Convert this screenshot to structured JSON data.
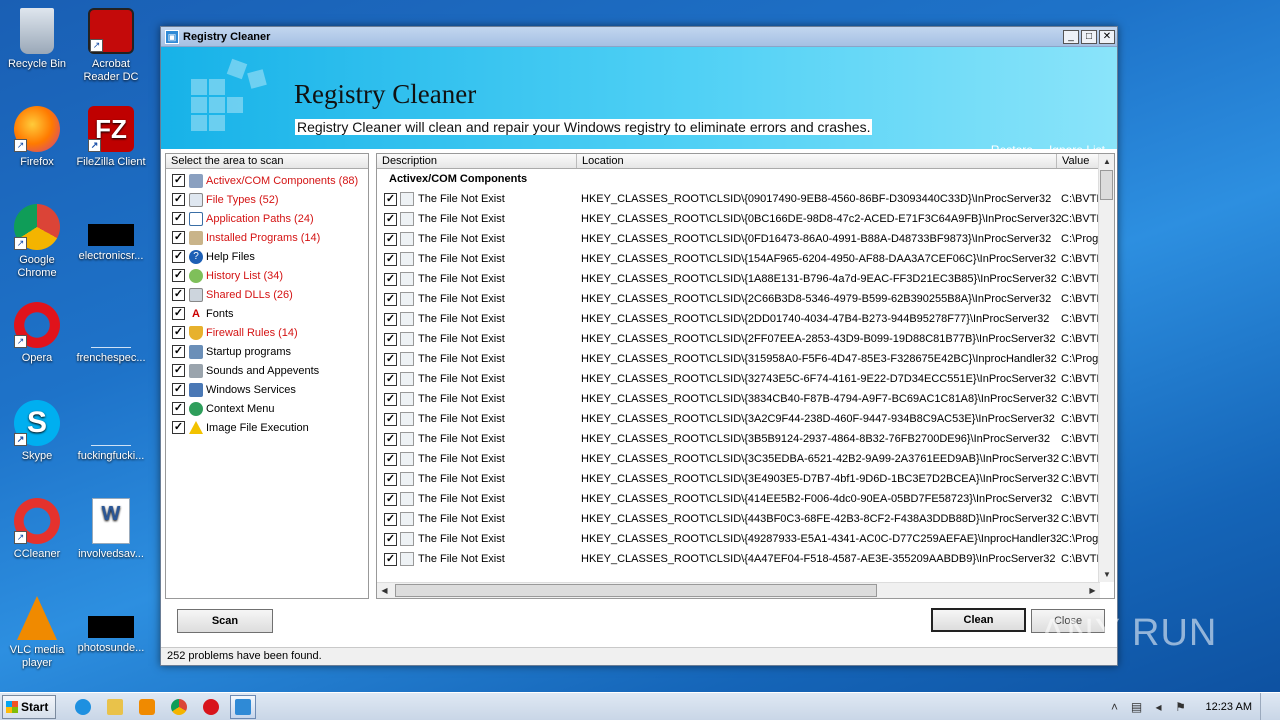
{
  "desktop": {
    "icons": [
      {
        "label": "Recycle Bin"
      },
      {
        "label": "Acrobat Reader DC"
      },
      {
        "label": "Firefox"
      },
      {
        "label": "FileZilla Client"
      },
      {
        "label": "Google Chrome"
      },
      {
        "label": "electronicsr..."
      },
      {
        "label": "Opera"
      },
      {
        "label": "frenchespec..."
      },
      {
        "label": "Skype"
      },
      {
        "label": "fuckingfucki..."
      },
      {
        "label": "CCleaner"
      },
      {
        "label": "involvedsav..."
      },
      {
        "label": "VLC media player"
      },
      {
        "label": "photosunde..."
      }
    ]
  },
  "window": {
    "title": "Registry Cleaner",
    "banner_title": "Registry Cleaner",
    "banner_subtitle": "Registry Cleaner will clean and repair your Windows registry to eliminate errors and crashes.",
    "links": {
      "restore": "Restore",
      "ignore_list": "Ignore List"
    },
    "controls": {
      "minimize": "_",
      "maximize": "□",
      "close": "✕"
    }
  },
  "left_panel": {
    "header": "Select the area to scan",
    "items": [
      {
        "label": "Activex/COM Components (88)",
        "red": true
      },
      {
        "label": "File Types (52)",
        "red": true
      },
      {
        "label": "Application Paths (24)",
        "red": true
      },
      {
        "label": "Installed Programs (14)",
        "red": true
      },
      {
        "label": "Help Files",
        "red": false
      },
      {
        "label": "History List (34)",
        "red": true
      },
      {
        "label": "Shared DLLs (26)",
        "red": true
      },
      {
        "label": "Fonts",
        "red": false
      },
      {
        "label": "Firewall Rules (14)",
        "red": true
      },
      {
        "label": "Startup programs",
        "red": false
      },
      {
        "label": "Sounds and Appevents",
        "red": false
      },
      {
        "label": "Windows Services",
        "red": false
      },
      {
        "label": "Context Menu",
        "red": false
      },
      {
        "label": "Image File Execution",
        "red": false
      }
    ]
  },
  "results": {
    "columns": {
      "description": "Description",
      "location": "Location",
      "value": "Value"
    },
    "group": "Activex/COM Components",
    "rows": [
      {
        "desc": "The File Not Exist",
        "loc": "HKEY_CLASSES_ROOT\\CLSID\\{09017490-9EB8-4560-86BF-D3093440C33D}\\InProcServer32",
        "val": "C:\\BVTE"
      },
      {
        "desc": "The File Not Exist",
        "loc": "HKEY_CLASSES_ROOT\\CLSID\\{0BC166DE-98D8-47c2-ACED-E71F3C64A9FB}\\InProcServer32",
        "val": "C:\\BVTE"
      },
      {
        "desc": "The File Not Exist",
        "loc": "HKEY_CLASSES_ROOT\\CLSID\\{0FD16473-86A0-4991-B88A-D48733BF9873}\\InProcServer32",
        "val": "C:\\Prog"
      },
      {
        "desc": "The File Not Exist",
        "loc": "HKEY_CLASSES_ROOT\\CLSID\\{154AF965-6204-4950-AF88-DAA3A7CEF06C}\\InProcServer32",
        "val": "C:\\BVTE"
      },
      {
        "desc": "The File Not Exist",
        "loc": "HKEY_CLASSES_ROOT\\CLSID\\{1A88E131-B796-4a7d-9EAC-FF3D21EC3B85}\\InProcServer32",
        "val": "C:\\BVTE"
      },
      {
        "desc": "The File Not Exist",
        "loc": "HKEY_CLASSES_ROOT\\CLSID\\{2C66B3D8-5346-4979-B599-62B390255B8A}\\InProcServer32",
        "val": "C:\\BVTE"
      },
      {
        "desc": "The File Not Exist",
        "loc": "HKEY_CLASSES_ROOT\\CLSID\\{2DD01740-4034-47B4-B273-944B95278F77}\\InProcServer32",
        "val": "C:\\BVTE"
      },
      {
        "desc": "The File Not Exist",
        "loc": "HKEY_CLASSES_ROOT\\CLSID\\{2FF07EEA-2853-43D9-B099-19D88C81B77B}\\InProcServer32",
        "val": "C:\\BVTE"
      },
      {
        "desc": "The File Not Exist",
        "loc": "HKEY_CLASSES_ROOT\\CLSID\\{315958A0-F5F6-4D47-85E3-F328675E42BC}\\InprocHandler32",
        "val": "C:\\Prog"
      },
      {
        "desc": "The File Not Exist",
        "loc": "HKEY_CLASSES_ROOT\\CLSID\\{32743E5C-6F74-4161-9E22-D7D34ECC551E}\\InProcServer32",
        "val": "C:\\BVTE"
      },
      {
        "desc": "The File Not Exist",
        "loc": "HKEY_CLASSES_ROOT\\CLSID\\{3834CB40-F87B-4794-A9F7-BC69AC1C81A8}\\InProcServer32",
        "val": "C:\\BVTE"
      },
      {
        "desc": "The File Not Exist",
        "loc": "HKEY_CLASSES_ROOT\\CLSID\\{3A2C9F44-238D-460F-9447-934B8C9AC53E}\\InProcServer32",
        "val": "C:\\BVTE"
      },
      {
        "desc": "The File Not Exist",
        "loc": "HKEY_CLASSES_ROOT\\CLSID\\{3B5B9124-2937-4864-8B32-76FB2700DE96}\\InProcServer32",
        "val": "C:\\BVTE"
      },
      {
        "desc": "The File Not Exist",
        "loc": "HKEY_CLASSES_ROOT\\CLSID\\{3C35EDBA-6521-42B2-9A99-2A3761EED9AB}\\InProcServer32",
        "val": "C:\\BVTE"
      },
      {
        "desc": "The File Not Exist",
        "loc": "HKEY_CLASSES_ROOT\\CLSID\\{3E4903E5-D7B7-4bf1-9D6D-1BC3E7D2BCEA}\\InProcServer32",
        "val": "C:\\BVTE"
      },
      {
        "desc": "The File Not Exist",
        "loc": "HKEY_CLASSES_ROOT\\CLSID\\{414EE5B2-F006-4dc0-90EA-05BD7FE58723}\\InProcServer32",
        "val": "C:\\BVTE"
      },
      {
        "desc": "The File Not Exist",
        "loc": "HKEY_CLASSES_ROOT\\CLSID\\{443BF0C3-68FE-42B3-8CF2-F438A3DDB88D}\\InProcServer32",
        "val": "C:\\BVTE"
      },
      {
        "desc": "The File Not Exist",
        "loc": "HKEY_CLASSES_ROOT\\CLSID\\{49287933-E5A1-4341-AC0C-D77C259AEFAE}\\InprocHandler32",
        "val": "C:\\Prog"
      },
      {
        "desc": "The File Not Exist",
        "loc": "HKEY_CLASSES_ROOT\\CLSID\\{4A47EF04-F518-4587-AE3E-355209AABDB9}\\InProcServer32",
        "val": "C:\\BVTE"
      }
    ]
  },
  "buttons": {
    "scan": "Scan",
    "clean": "Clean",
    "close": "Close"
  },
  "status": "252  problems have been found.",
  "watermark": "ANY RUN",
  "taskbar": {
    "start": "Start",
    "clock": "12:23 AM"
  },
  "colors": {
    "banner": "#17b2e8",
    "problem_text": "#d41414",
    "desktop": "#1e73c9"
  }
}
